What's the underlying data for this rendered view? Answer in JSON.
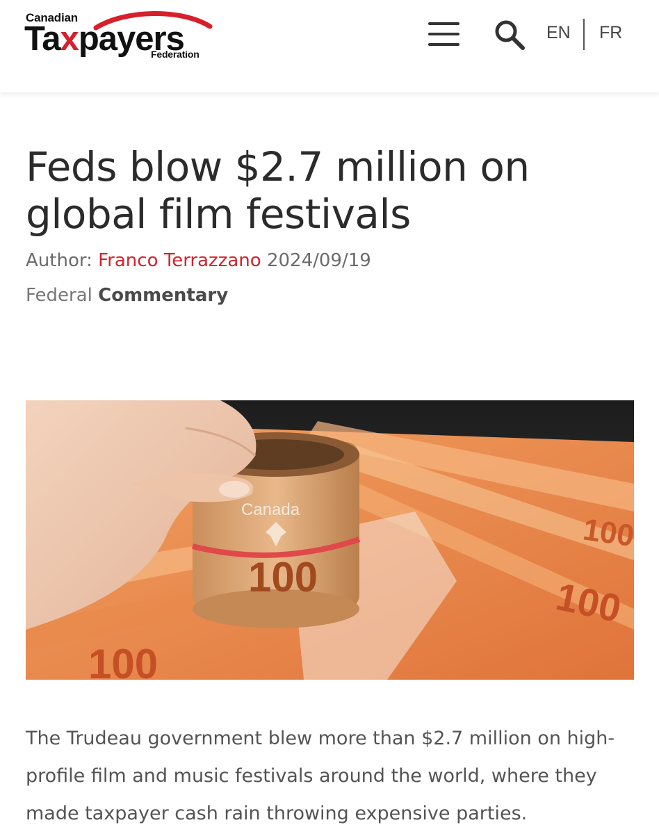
{
  "header": {
    "logo": {
      "top_word": "Canadian",
      "main_word_a": "Ta",
      "main_word_x": "x",
      "main_word_b": "payers",
      "bottom_word": "Federation",
      "accent_color": "#d7202b"
    },
    "menu_icon": "hamburger-icon",
    "search_icon": "search-icon",
    "languages": [
      "EN",
      "FR"
    ]
  },
  "article": {
    "title": "Feds blow $2.7 million on global film festivals",
    "author_label": "Author:",
    "author_name": "Franco Terrazzano",
    "date": "2024/09/19",
    "category_1": "Federal",
    "category_2": "Commentary",
    "hero_image": {
      "note": "Hand holding a rolled bundle of Canadian $100 banknotes above a fan of banknotes",
      "roll_text": "Canada",
      "roll_value": "100",
      "bill_value": "100"
    },
    "lead_paragraph": "The Trudeau government blew more than $2.7 million on high-profile film and music festivals around the world, where they made taxpayer cash rain throwing expensive parties."
  },
  "colors": {
    "accent": "#d7202b",
    "banknote": "#e8884a",
    "text": "#2b2b2b"
  }
}
